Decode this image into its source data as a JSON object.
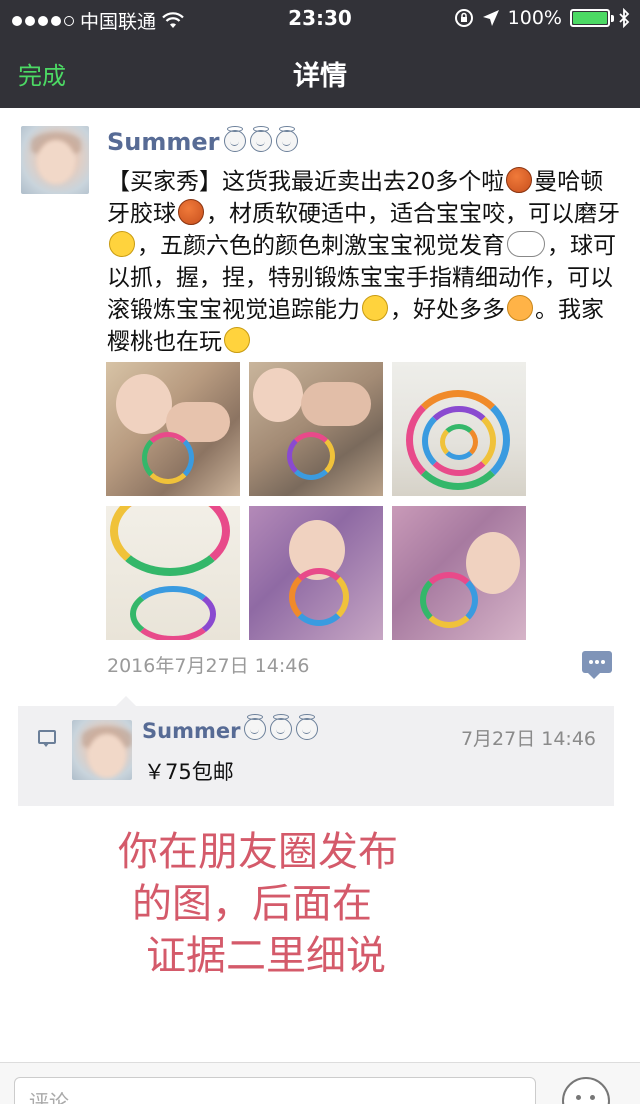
{
  "status_bar": {
    "carrier": "中国联通",
    "time": "23:30",
    "battery": "100%",
    "battery_level": 1.0
  },
  "nav": {
    "done_label": "完成",
    "title": "详情"
  },
  "post": {
    "username": "Summer",
    "text_segments": [
      "【买家秀】这货我最近卖出去20多个啦",
      "曼哈顿牙胶球",
      "，材质软硬适中，适合宝宝咬，可以磨牙",
      "，五颜六色的颜色刺激宝宝视觉发育",
      "，球可以抓，握，捏，特别锻炼宝宝手指精细动作，可以滚锻炼宝宝视觉追踪能力",
      "，好处多多",
      "。我家樱桃也在玩"
    ],
    "time": "2016年7月27日 14:46",
    "photo_count": 6
  },
  "comment": {
    "username": "Summer",
    "time": "7月27日 14:46",
    "text": "￥75包邮"
  },
  "overlay": {
    "line1": "你在朋友圈发布",
    "line2": "的图，后面在",
    "line3": "证据二里细说"
  },
  "bottom": {
    "comment_placeholder": "评论"
  },
  "colors": {
    "bar_bg": "#323238",
    "accent_green": "#4cd964",
    "username_blue": "#576b95",
    "overlay_red": "#d45a6a"
  },
  "icons": [
    "signal-dots-icon",
    "wifi-icon",
    "lock-rotation-icon",
    "location-arrow-icon",
    "battery-icon",
    "bluetooth-icon",
    "comment-more-icon",
    "comment-bubble-icon",
    "emoji-icon"
  ]
}
